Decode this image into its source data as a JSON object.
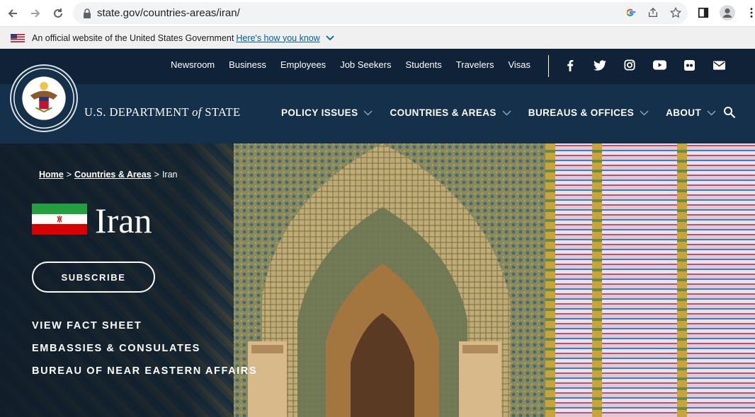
{
  "browser": {
    "url": "state.gov/countries-areas/iran/"
  },
  "gov_banner": {
    "text": "An official website of the United States Government",
    "link": "Here's how you know"
  },
  "header": {
    "dept_name_1": "U.S. DEPARTMENT ",
    "dept_name_of": "of",
    "dept_name_2": " STATE",
    "top_links": [
      "Newsroom",
      "Business",
      "Employees",
      "Job Seekers",
      "Students",
      "Travelers",
      "Visas"
    ],
    "main_nav": [
      "POLICY ISSUES",
      "COUNTRIES & AREAS",
      "BUREAUS & OFFICES",
      "ABOUT"
    ],
    "social_icons": [
      "facebook-icon",
      "twitter-icon",
      "instagram-icon",
      "youtube-icon",
      "flickr-icon",
      "email-icon"
    ]
  },
  "hero": {
    "breadcrumb": {
      "home": "Home",
      "sep": ">",
      "countries": "Countries & Areas",
      "current": "Iran"
    },
    "title": "Iran",
    "subscribe": "SUBSCRIBE",
    "links": [
      "VIEW FACT SHEET",
      "EMBASSIES & CONSULATES",
      "BUREAU OF NEAR EASTERN AFFAIRS"
    ]
  },
  "colors": {
    "header_dark": "#0f2237",
    "header_main": "#15304a",
    "gov_link": "#005ea2"
  }
}
